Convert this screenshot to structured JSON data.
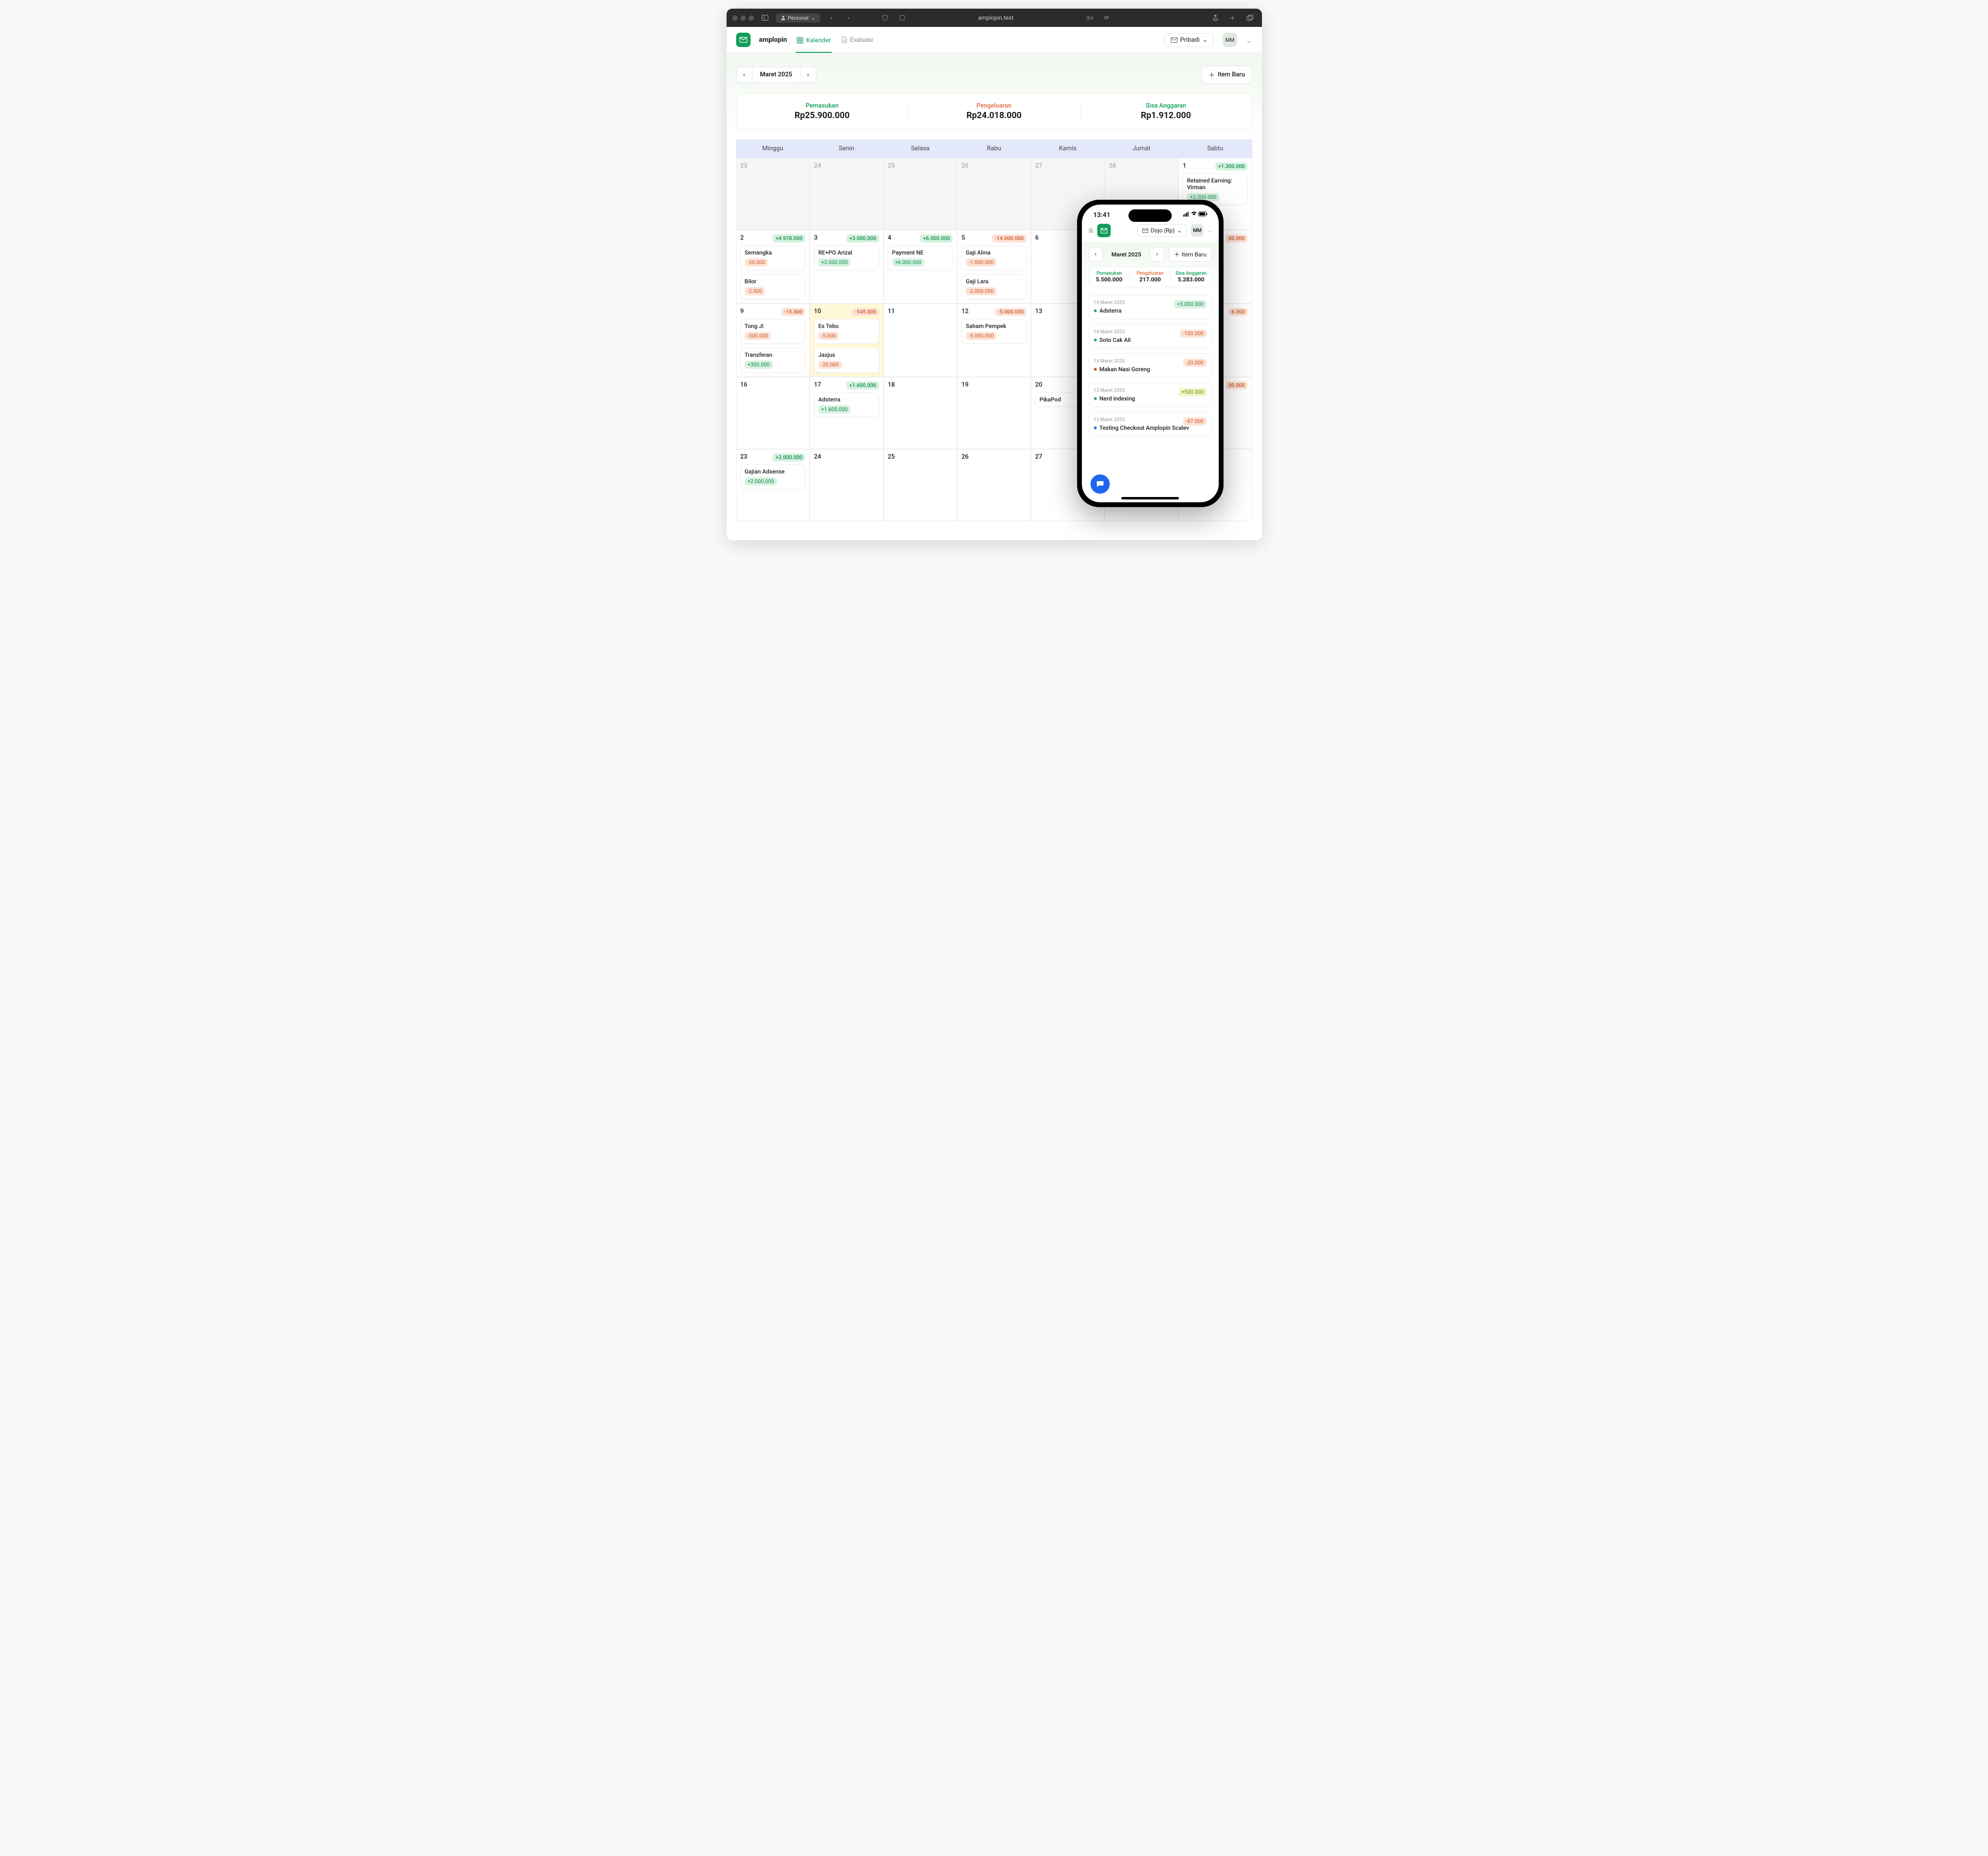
{
  "browser": {
    "personal": "Personal",
    "url": "amplopin.test"
  },
  "app": {
    "brand": "amplopin",
    "nav_calendar": "Kalender",
    "nav_eval": "Evaluasi",
    "scope": "Pribadi",
    "avatar": "MM"
  },
  "month": {
    "label": "Maret 2025",
    "new_item": "Item Baru"
  },
  "stats": {
    "in_label": "Pemasukan",
    "in_value": "Rp25.900.000",
    "out_label": "Pengeluaran",
    "out_value": "Rp24.018.000",
    "rem_label": "Sisa Anggaran",
    "rem_value": "Rp1.912.000"
  },
  "weekdays": [
    "Minggu",
    "Senin",
    "Selasa",
    "Rabu",
    "Kamis",
    "Jumat",
    "Sabtu"
  ],
  "cells": {
    "sat1": {
      "badge": "+1.300.000",
      "e1_title": "Retained Earning: Virman",
      "e1_amt": "+2.000.000"
    },
    "sun2": {
      "badge": "+4.978.000",
      "e1_title": "Semangka",
      "e1_amt": "-20.000",
      "e2_title": "Bilor",
      "e2_amt": "-2.000"
    },
    "mon3": {
      "badge": "+3.000.000",
      "e1_title": "RE+PO Arizal",
      "e1_amt": "+3.000.000"
    },
    "tue4": {
      "badge": "+6.000.000",
      "e1_title": "Payment NE",
      "e1_amt": "+6.000.000"
    },
    "wed5": {
      "badge": "-14.000.000",
      "e1_title": "Gaji Alma",
      "e1_amt": "-1.000.000",
      "e2_title": "Gaji Lara",
      "e2_amt": "-2.000.000"
    },
    "sat8": {
      "badge": "00.000"
    },
    "sun9": {
      "badge": "-15.000",
      "e1_title": "Tong Ji",
      "e1_amt": "-300.000",
      "e2_title": "Transferan",
      "e2_amt": "+300.000"
    },
    "mon10": {
      "badge": "-545.000",
      "e1_title": "Es Tebu",
      "e1_amt": "-5.000",
      "e2_title": "Jasjus",
      "e2_amt": "-20.000"
    },
    "wed12": {
      "badge": "-5.000.000",
      "e1_title": "Saham Pempek",
      "e1_amt": "-5.000.000"
    },
    "sat15": {
      "badge": "6.000"
    },
    "mon17": {
      "badge": "+1.600.000",
      "e1_title": "Adsterra",
      "e1_amt": "+1.600.000"
    },
    "thu20": {
      "e1_title": "PikaPod"
    },
    "sat22": {
      "badge": "00.000"
    },
    "sun23": {
      "badge": "+2.000.000",
      "e1_title": "Gajian Adsense",
      "e1_amt": "+2.000.000"
    }
  },
  "phone": {
    "time": "13:41",
    "scope": "Dojo (Rp)",
    "avatar": "MM",
    "month": "Maret 2025",
    "new_item": "Item Baru",
    "in_label": "Pemasukan",
    "in_value": "5.500.000",
    "out_label": "Pengeluaran",
    "out_value": "217.000",
    "rem_label": "Sisa Anggaran",
    "rem_value": "5.283.000",
    "items": [
      {
        "date": "14 Maret 2025",
        "title": "Adsterra",
        "amt": "+5.000.000",
        "cls": "pos",
        "dot": "pd-g"
      },
      {
        "date": "14 Maret 2025",
        "title": "Soto Cak Ali",
        "amt": "-100.000",
        "cls": "neg",
        "dot": "pd-g"
      },
      {
        "date": "14 Maret 2025",
        "title": "Makan Nasi Goreng",
        "amt": "-20.000",
        "cls": "neg",
        "dot": "pd-r"
      },
      {
        "date": "13 Maret 2025",
        "title": "Nerd indexing",
        "amt": "+500.000",
        "cls": "lime",
        "dot": "pd-g"
      },
      {
        "date": "13 Maret 2025",
        "title": "Testing Checkout Amplopin Scalev",
        "amt": "-97.000",
        "cls": "neg",
        "dot": "pd-b"
      }
    ]
  }
}
